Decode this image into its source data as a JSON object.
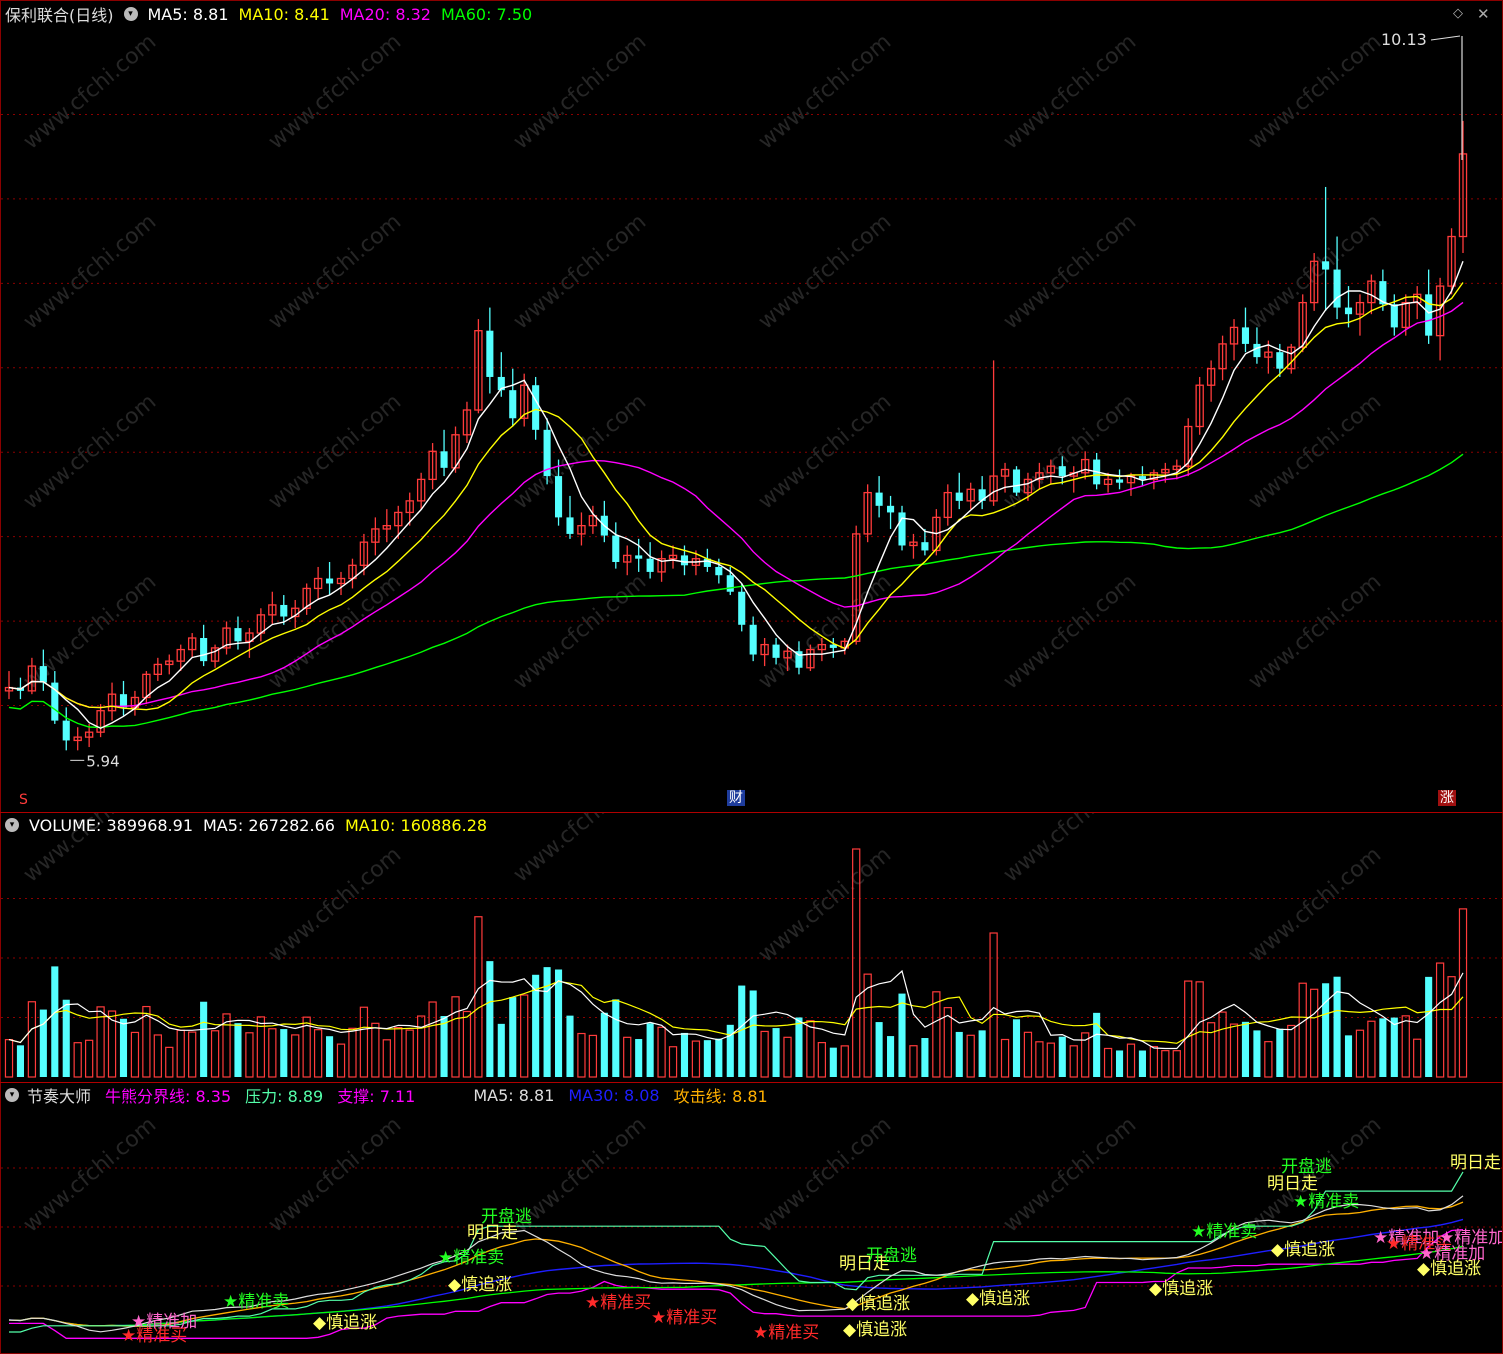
{
  "price_header": {
    "stock": "保利联合(日线)",
    "ma5": "MA5: 8.81",
    "ma10": "MA10: 8.41",
    "ma20": "MA20: 8.32",
    "ma60": "MA60: 7.50"
  },
  "price_marks": {
    "high": "10.13",
    "low": "5.94"
  },
  "bottom_tags": {
    "left": "S",
    "middle": "财",
    "right": "涨"
  },
  "volume_header": {
    "name": "VOLUME: 389968.91",
    "ma5": "MA5: 267282.66",
    "ma10": "MA10: 160886.28"
  },
  "indicator_header": {
    "name": "节奏大师",
    "bull_bear": "牛熊分界线: 8.35",
    "pressure": "压力: 8.89",
    "support": "支撑: 7.11",
    "ma5": "MA5: 8.81",
    "ma30": "MA30: 8.08",
    "attack": "攻击线: 8.81"
  },
  "signals": {
    "sell": "★精准卖",
    "buy": "★精准买",
    "chase": "◆慎追涨",
    "add": "★精准加",
    "tomorrow": "明日走",
    "flee": "开盘逃"
  },
  "watermark": "www.cfchi.com",
  "colors": {
    "up": "#ff3b3b",
    "down": "#54ffff",
    "ma5": "#ffffff",
    "ma10": "#ffff00",
    "ma20": "#ff00ff",
    "ma60": "#00ff00",
    "ma30": "#1e1eff",
    "grid": "#8b0000",
    "pressure": "#54ffaa",
    "attack": "#ffb000"
  },
  "chart_data": {
    "type": "candlestick",
    "title": "保利联合(日线)",
    "y_range_visible": [
      5.7,
      10.3
    ],
    "candles": [
      [
        6.3,
        6.42,
        6.25,
        6.32
      ],
      [
        6.32,
        6.38,
        6.25,
        6.3
      ],
      [
        6.3,
        6.5,
        6.28,
        6.45
      ],
      [
        6.45,
        6.55,
        6.3,
        6.35
      ],
      [
        6.35,
        6.42,
        6.1,
        6.12
      ],
      [
        6.12,
        6.2,
        5.94,
        6.0
      ],
      [
        6.0,
        6.08,
        5.94,
        6.02
      ],
      [
        6.02,
        6.1,
        5.96,
        6.05
      ],
      [
        6.05,
        6.22,
        6.02,
        6.18
      ],
      [
        6.18,
        6.35,
        6.12,
        6.28
      ],
      [
        6.28,
        6.36,
        6.15,
        6.2
      ],
      [
        6.2,
        6.3,
        6.15,
        6.26
      ],
      [
        6.26,
        6.42,
        6.22,
        6.4
      ],
      [
        6.4,
        6.5,
        6.36,
        6.46
      ],
      [
        6.46,
        6.52,
        6.4,
        6.48
      ],
      [
        6.48,
        6.58,
        6.42,
        6.55
      ],
      [
        6.55,
        6.65,
        6.5,
        6.62
      ],
      [
        6.62,
        6.7,
        6.45,
        6.48
      ],
      [
        6.48,
        6.58,
        6.44,
        6.56
      ],
      [
        6.56,
        6.72,
        6.52,
        6.68
      ],
      [
        6.68,
        6.75,
        6.55,
        6.6
      ],
      [
        6.6,
        6.68,
        6.5,
        6.65
      ],
      [
        6.65,
        6.8,
        6.6,
        6.76
      ],
      [
        6.76,
        6.9,
        6.7,
        6.82
      ],
      [
        6.82,
        6.88,
        6.7,
        6.75
      ],
      [
        6.75,
        6.85,
        6.68,
        6.8
      ],
      [
        6.8,
        6.95,
        6.76,
        6.92
      ],
      [
        6.92,
        7.05,
        6.85,
        6.98
      ],
      [
        6.98,
        7.08,
        6.88,
        6.95
      ],
      [
        6.95,
        7.02,
        6.88,
        6.98
      ],
      [
        6.98,
        7.1,
        6.92,
        7.06
      ],
      [
        7.06,
        7.25,
        7.0,
        7.2
      ],
      [
        7.2,
        7.35,
        7.12,
        7.28
      ],
      [
        7.28,
        7.4,
        7.2,
        7.3
      ],
      [
        7.3,
        7.42,
        7.22,
        7.38
      ],
      [
        7.38,
        7.5,
        7.3,
        7.45
      ],
      [
        7.45,
        7.62,
        7.4,
        7.58
      ],
      [
        7.58,
        7.8,
        7.52,
        7.75
      ],
      [
        7.75,
        7.88,
        7.6,
        7.65
      ],
      [
        7.65,
        7.9,
        7.62,
        7.85
      ],
      [
        7.85,
        8.05,
        7.8,
        8.0
      ],
      [
        8.0,
        8.55,
        7.98,
        8.48
      ],
      [
        8.48,
        8.62,
        8.1,
        8.2
      ],
      [
        8.2,
        8.35,
        8.08,
        8.12
      ],
      [
        8.12,
        8.25,
        7.9,
        7.95
      ],
      [
        7.95,
        8.22,
        7.9,
        8.15
      ],
      [
        8.15,
        8.2,
        7.82,
        7.88
      ],
      [
        7.88,
        7.95,
        7.55,
        7.6
      ],
      [
        7.6,
        7.7,
        7.3,
        7.35
      ],
      [
        7.35,
        7.48,
        7.22,
        7.25
      ],
      [
        7.25,
        7.38,
        7.18,
        7.3
      ],
      [
        7.3,
        7.42,
        7.25,
        7.36
      ],
      [
        7.36,
        7.45,
        7.2,
        7.24
      ],
      [
        7.24,
        7.32,
        7.04,
        7.08
      ],
      [
        7.08,
        7.18,
        7.0,
        7.12
      ],
      [
        7.12,
        7.22,
        7.02,
        7.1
      ],
      [
        7.1,
        7.2,
        6.98,
        7.02
      ],
      [
        7.02,
        7.15,
        6.96,
        7.1
      ],
      [
        7.1,
        7.18,
        7.04,
        7.12
      ],
      [
        7.12,
        7.18,
        7.0,
        7.06
      ],
      [
        7.06,
        7.15,
        7.0,
        7.1
      ],
      [
        7.1,
        7.16,
        7.02,
        7.05
      ],
      [
        7.05,
        7.1,
        6.95,
        7.0
      ],
      [
        7.0,
        7.05,
        6.88,
        6.9
      ],
      [
        6.9,
        6.95,
        6.66,
        6.7
      ],
      [
        6.7,
        6.75,
        6.48,
        6.52
      ],
      [
        6.52,
        6.62,
        6.45,
        6.58
      ],
      [
        6.58,
        6.62,
        6.46,
        6.5
      ],
      [
        6.5,
        6.58,
        6.42,
        6.54
      ],
      [
        6.54,
        6.6,
        6.4,
        6.44
      ],
      [
        6.44,
        6.58,
        6.42,
        6.55
      ],
      [
        6.55,
        6.62,
        6.48,
        6.58
      ],
      [
        6.58,
        6.62,
        6.5,
        6.56
      ],
      [
        6.56,
        6.62,
        6.52,
        6.6
      ],
      [
        6.6,
        7.3,
        6.58,
        7.25
      ],
      [
        7.25,
        7.55,
        7.2,
        7.5
      ],
      [
        7.5,
        7.6,
        7.35,
        7.42
      ],
      [
        7.42,
        7.48,
        7.28,
        7.38
      ],
      [
        7.38,
        7.42,
        7.15,
        7.18
      ],
      [
        7.18,
        7.25,
        7.1,
        7.2
      ],
      [
        7.2,
        7.28,
        7.12,
        7.15
      ],
      [
        7.15,
        7.4,
        7.12,
        7.35
      ],
      [
        7.35,
        7.55,
        7.3,
        7.5
      ],
      [
        7.5,
        7.62,
        7.4,
        7.45
      ],
      [
        7.45,
        7.56,
        7.4,
        7.52
      ],
      [
        7.52,
        7.6,
        7.4,
        7.45
      ],
      [
        7.45,
        8.3,
        7.42,
        7.6
      ],
      [
        7.6,
        7.68,
        7.5,
        7.64
      ],
      [
        7.64,
        7.66,
        7.48,
        7.5
      ],
      [
        7.5,
        7.62,
        7.45,
        7.58
      ],
      [
        7.58,
        7.68,
        7.52,
        7.62
      ],
      [
        7.62,
        7.7,
        7.55,
        7.66
      ],
      [
        7.66,
        7.72,
        7.55,
        7.6
      ],
      [
        7.6,
        7.66,
        7.5,
        7.62
      ],
      [
        7.62,
        7.75,
        7.58,
        7.7
      ],
      [
        7.7,
        7.74,
        7.52,
        7.55
      ],
      [
        7.55,
        7.62,
        7.5,
        7.58
      ],
      [
        7.58,
        7.64,
        7.52,
        7.56
      ],
      [
        7.56,
        7.62,
        7.48,
        7.6
      ],
      [
        7.6,
        7.66,
        7.54,
        7.58
      ],
      [
        7.58,
        7.64,
        7.52,
        7.62
      ],
      [
        7.62,
        7.68,
        7.56,
        7.64
      ],
      [
        7.64,
        7.7,
        7.58,
        7.66
      ],
      [
        7.66,
        7.95,
        7.6,
        7.9
      ],
      [
        7.9,
        8.2,
        7.85,
        8.15
      ],
      [
        8.15,
        8.3,
        8.05,
        8.25
      ],
      [
        8.25,
        8.45,
        8.18,
        8.4
      ],
      [
        8.4,
        8.55,
        8.3,
        8.5
      ],
      [
        8.5,
        8.62,
        8.35,
        8.4
      ],
      [
        8.4,
        8.5,
        8.28,
        8.32
      ],
      [
        8.32,
        8.42,
        8.22,
        8.35
      ],
      [
        8.35,
        8.4,
        8.2,
        8.25
      ],
      [
        8.25,
        8.4,
        8.22,
        8.38
      ],
      [
        8.38,
        8.7,
        8.35,
        8.65
      ],
      [
        8.65,
        8.95,
        8.6,
        8.9
      ],
      [
        8.9,
        9.35,
        8.6,
        8.85
      ],
      [
        8.85,
        9.05,
        8.55,
        8.62
      ],
      [
        8.62,
        8.75,
        8.5,
        8.58
      ],
      [
        8.58,
        8.7,
        8.45,
        8.65
      ],
      [
        8.65,
        8.82,
        8.58,
        8.78
      ],
      [
        8.78,
        8.85,
        8.6,
        8.64
      ],
      [
        8.64,
        8.7,
        8.45,
        8.5
      ],
      [
        8.5,
        8.7,
        8.45,
        8.65
      ],
      [
        8.65,
        8.75,
        8.55,
        8.7
      ],
      [
        8.7,
        8.85,
        8.4,
        8.45
      ],
      [
        8.45,
        8.8,
        8.3,
        8.75
      ],
      [
        8.75,
        9.1,
        8.7,
        9.05
      ],
      [
        9.05,
        9.75,
        8.95,
        9.55
      ]
    ]
  }
}
